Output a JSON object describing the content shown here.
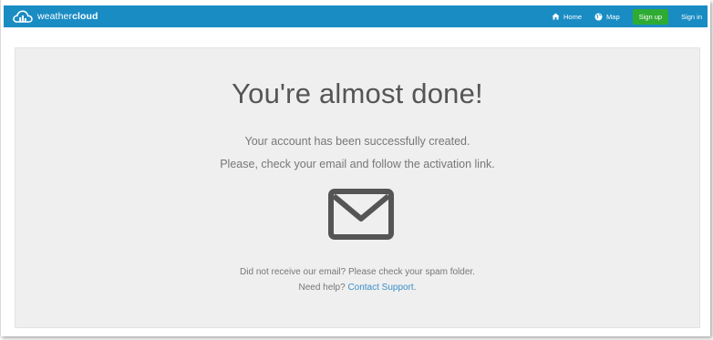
{
  "header": {
    "brand_light": "weather",
    "brand_bold": "cloud",
    "nav": {
      "home": "Home",
      "map": "Map",
      "signup": "Sign up",
      "signin": "Sign in"
    }
  },
  "main": {
    "heading": "You're almost done!",
    "line1": "Your account has been successfully created.",
    "line2": "Please, check your email and follow the activation link.",
    "envelope_icon": "envelope-icon",
    "help1": "Did not receive our email? Please check your spam folder.",
    "help2_prefix": "Need help? ",
    "help2_link": "Contact Support",
    "help2_suffix": "."
  },
  "colors": {
    "navbar": "#1a8cc4",
    "signup": "#2eab33",
    "panel": "#efefef",
    "link": "#3a8fc8"
  }
}
